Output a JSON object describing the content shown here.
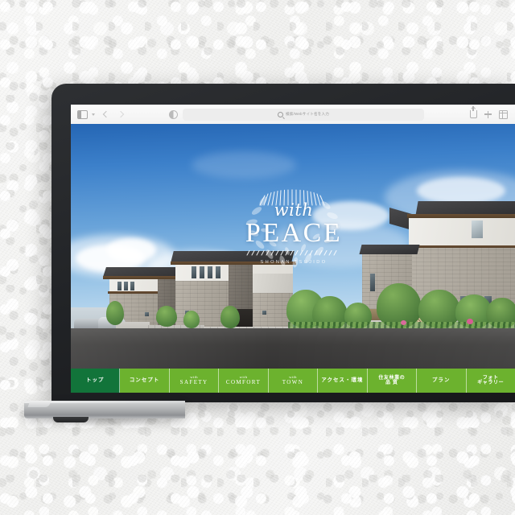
{
  "browser": {
    "icons": {
      "sidebar": "sidebar-icon",
      "sidebar_caret": "chevron-down-icon",
      "back": "chevron-left-icon",
      "forward": "chevron-right-icon",
      "reader": "appearance-icon",
      "search": "search-icon",
      "share": "share-icon",
      "new_tab": "plus-icon",
      "tab_overview": "tab-overview-icon"
    },
    "address_bar": {
      "value": "",
      "placeholder": "検索/Webサイト名を入力"
    }
  },
  "site": {
    "logo": {
      "script": "with",
      "wordmark": "PEACE",
      "subtitle": "SHONAN TSUJIDO"
    },
    "nav": [
      {
        "jp": "トップ",
        "small": "",
        "en": "",
        "active": true
      },
      {
        "jp": "コンセプト",
        "small": "",
        "en": "",
        "active": false
      },
      {
        "jp": "",
        "small": "with",
        "en": "SAFETY",
        "active": false
      },
      {
        "jp": "",
        "small": "with",
        "en": "COMFORT",
        "active": false
      },
      {
        "jp": "",
        "small": "with",
        "en": "TOWN",
        "active": false
      },
      {
        "jp": "アクセス・環境",
        "small": "",
        "en": "",
        "active": false
      },
      {
        "jp": "住友林業の\n品 質",
        "small": "",
        "en": "",
        "active": false
      },
      {
        "jp": "プラン",
        "small": "",
        "en": "",
        "active": false
      },
      {
        "jp": "フォト\nギャラリー",
        "small": "",
        "en": "",
        "active": false
      }
    ]
  },
  "colors": {
    "nav_base": "#6cb22e",
    "nav_active": "#12743a",
    "sky_top": "#2566b4",
    "sky_bottom": "#e3eef6",
    "bezel": "#212326",
    "base_metal": "#a9abad",
    "wall": "#f3f3f2"
  }
}
